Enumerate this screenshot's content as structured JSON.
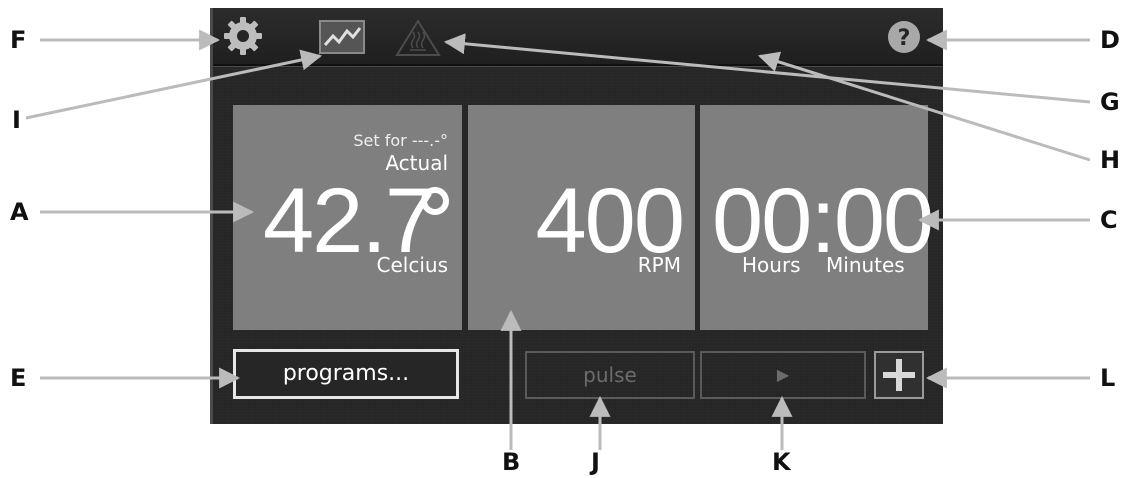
{
  "screen": {
    "toolbar": {
      "settings_icon": "gear-icon",
      "graph_icon": "graph-icon",
      "heater_icon": "heater-warning-icon",
      "help_icon": "help-icon"
    },
    "temperature": {
      "set_for": "Set for ---.-°",
      "actual_label": "Actual",
      "value": "42.7",
      "unit": "Celcius"
    },
    "speed": {
      "value": "400",
      "unit": "RPM"
    },
    "timer": {
      "value": "00:00",
      "hours_label": "Hours",
      "minutes_label": "Minutes"
    },
    "buttons": {
      "programs": "programs...",
      "pulse": "pulse",
      "play": "▶",
      "plus": "plus-icon"
    }
  },
  "callouts": [
    "A",
    "B",
    "C",
    "D",
    "E",
    "F",
    "G",
    "H",
    "I",
    "J",
    "K",
    "L"
  ]
}
